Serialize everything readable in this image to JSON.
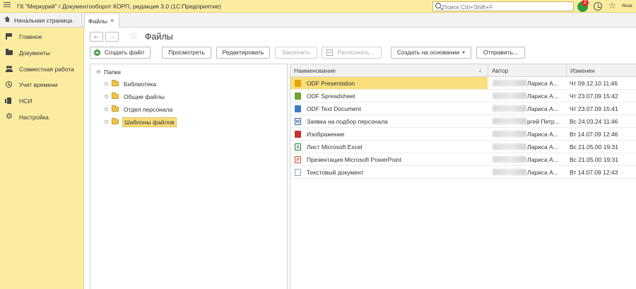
{
  "titlebar": {
    "title": "ГК \"Меркурий\" / Документооборот КОРП, редакция 3.0  (1С:Предприятие)",
    "search_placeholder": "Поиск Ctrl+Shift+F",
    "notifications_count": "2",
    "user": "Яков"
  },
  "tabs": {
    "home": "Начальная страница",
    "active": "Файлы",
    "close": "×"
  },
  "sidebar": {
    "items": [
      {
        "label": "Главное",
        "icon": "flag-icon"
      },
      {
        "label": "Документы",
        "icon": "folder-icon"
      },
      {
        "label": "Совместная работа",
        "icon": "people-icon"
      },
      {
        "label": "Учет времени",
        "icon": "clock-icon"
      },
      {
        "label": "НСИ",
        "icon": "book-icon"
      },
      {
        "label": "Настройка",
        "icon": "gear-icon"
      }
    ]
  },
  "page": {
    "title": "Файлы",
    "back": "←",
    "forward": "→"
  },
  "toolbar": {
    "create": "Создать файл",
    "view": "Просмотреть",
    "edit": "Редактировать",
    "finish": "Закончить",
    "recognize": "Распознать...",
    "create_based": "Создать на основании",
    "send": "Отправить..."
  },
  "tree": {
    "root": "Папки",
    "folders": [
      "Библиотека",
      "Общие файлы",
      "Отдел персонала",
      "Шаблоны файлов"
    ]
  },
  "list": {
    "columns": {
      "name": "Наименование",
      "author": "Автор",
      "modified": "Изменен"
    },
    "sort_arrow": "↓",
    "rows": [
      {
        "name": "ODF Presentation",
        "author": "Лариса А...",
        "date": "Чт 09.12.10 11:46",
        "icon": "odp",
        "icon_glyph": ""
      },
      {
        "name": "ODF Spreadsheet",
        "author": "Лариса А...",
        "date": "Чт 23.07.09 15:42",
        "icon": "ods",
        "icon_glyph": ""
      },
      {
        "name": "ODF Text Document",
        "author": "Лариса А...",
        "date": "Чт 23.07.09 15:41",
        "icon": "odt",
        "icon_glyph": ""
      },
      {
        "name": "Заявка на подбор персонала",
        "author": "ргей Петр...",
        "date": "Вс 24.03.24 11:46",
        "icon": "doc",
        "icon_glyph": "W"
      },
      {
        "name": "Изображение",
        "author": "Лариса А...",
        "date": "Вт 14.07.09 12:46",
        "icon": "img",
        "icon_glyph": ""
      },
      {
        "name": "Лист Microsoft Excel",
        "author": "Лариса А...",
        "date": "Вс 21.05.00 19:31",
        "icon": "xls",
        "icon_glyph": "X"
      },
      {
        "name": "Презентация Microsoft PowerPoint",
        "author": "Лариса А...",
        "date": "Вс 21.05.00 19:31",
        "icon": "ppt",
        "icon_glyph": "P"
      },
      {
        "name": "Текстовый документ",
        "author": "Лариса А...",
        "date": "Вт 14.07.09 12:43",
        "icon": "txt",
        "icon_glyph": ""
      }
    ]
  }
}
